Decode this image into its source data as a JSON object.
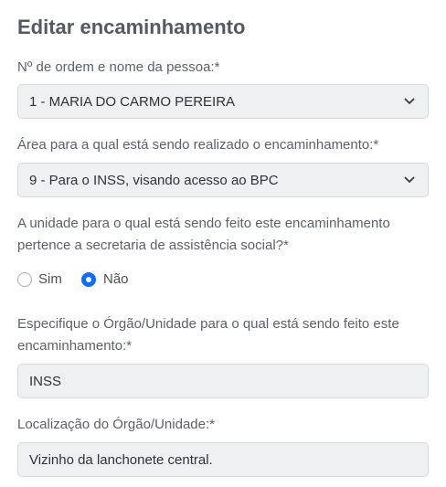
{
  "form": {
    "title": "Editar encaminhamento",
    "person": {
      "label": "Nº de ordem e nome da pessoa:*",
      "value": "1 - MARIA DO CARMO PEREIRA"
    },
    "area": {
      "label": "Área para a qual está sendo realizado o encaminhamento:*",
      "value": "9 - Para o INSS, visando acesso ao BPC"
    },
    "unit_question": {
      "label": "A unidade para o qual está sendo feito este encaminhamento pertence a secretaria de assistência social?*",
      "options": [
        {
          "label": "Sim",
          "selected": false
        },
        {
          "label": "Não",
          "selected": true
        }
      ]
    },
    "organ": {
      "label": "Especifique o Órgão/Unidade para o qual está sendo feito este encaminhamento:*",
      "value": "INSS"
    },
    "location": {
      "label": "Localização do Órgão/Unidade:*",
      "value": "Vizinho da lanchonete central."
    }
  },
  "colors": {
    "accent": "#0d6efd",
    "field_bg": "#eef0f2"
  }
}
